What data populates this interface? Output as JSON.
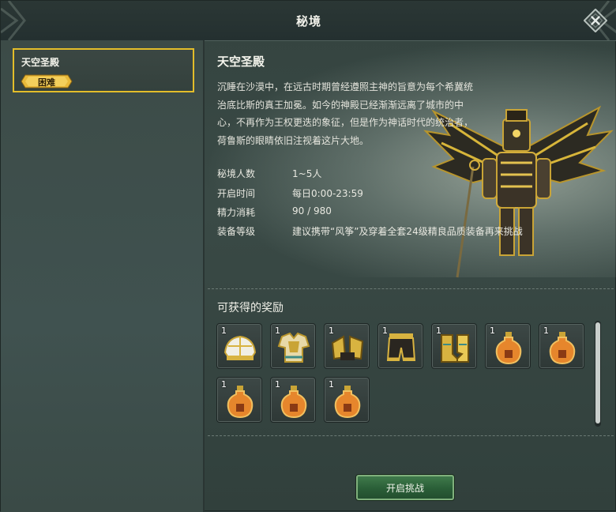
{
  "window": {
    "title": "秘境"
  },
  "sidebar": {
    "dungeons": [
      {
        "name": "天空圣殿",
        "difficulty": "困难",
        "selected": true
      }
    ]
  },
  "detail": {
    "name": "天空圣殿",
    "description": "沉睡在沙漠中，在远古时期曾经遵照主神的旨意为每个希冀统治底比斯的真王加冕。如今的神殿已经渐渐远离了城市的中心，不再作为王权更迭的象征，但是作为神话时代的统治者，荷鲁斯的眼睛依旧注视着这片大地。",
    "info": [
      {
        "label": "秘境人数",
        "value": "1~5人"
      },
      {
        "label": "开启时间",
        "value": "每日0:00-23:59"
      },
      {
        "label": "精力消耗",
        "value": "90 / 980"
      },
      {
        "label": "装备等级",
        "value": "建议携带“风筝”及穿着全套24级精良品质装备再来挑战"
      }
    ]
  },
  "rewards": {
    "title": "可获得的奖励",
    "items": [
      {
        "count": "1",
        "icon": "golden-helmet-icon"
      },
      {
        "count": "1",
        "icon": "golden-chest-armor-icon"
      },
      {
        "count": "1",
        "icon": "golden-pauldrons-icon"
      },
      {
        "count": "1",
        "icon": "dark-leggings-icon"
      },
      {
        "count": "1",
        "icon": "golden-boots-icon"
      },
      {
        "count": "1",
        "icon": "potion-bottle-icon"
      },
      {
        "count": "1",
        "icon": "potion-bottle-icon"
      },
      {
        "count": "1",
        "icon": "potion-bottle-icon"
      },
      {
        "count": "1",
        "icon": "potion-bottle-icon"
      },
      {
        "count": "1",
        "icon": "potion-bottle-icon"
      }
    ]
  },
  "actions": {
    "start_label": "开启挑战"
  },
  "colors": {
    "selected_border": "#e3bd2a",
    "badge_gold": "#e8b93a",
    "button_green": "#2a5e37"
  }
}
